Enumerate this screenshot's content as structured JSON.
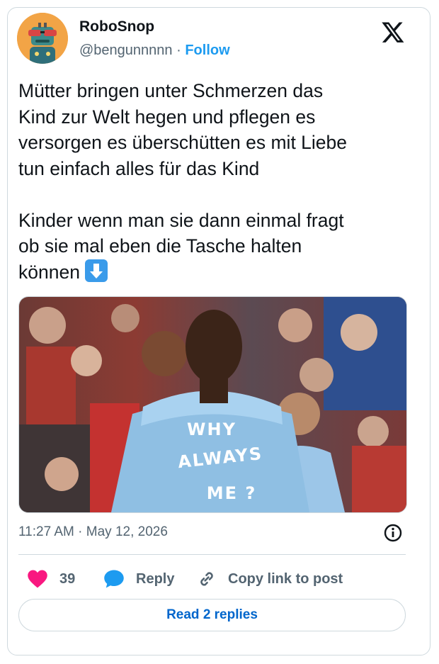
{
  "author": {
    "name": "RoboSnop",
    "handle": "@bengunnnnn",
    "separator": "·",
    "follow_label": "Follow"
  },
  "tweet": {
    "text_lines": [
      "Mütter bringen unter Schmerzen das",
      "Kind zur Welt hegen und pflegen es",
      "versorgen es überschütten es mit Liebe",
      "tun einfach alles für das Kind",
      "",
      "Kinder wenn man sie dann einmal fragt",
      "ob sie mal eben die Tasche halten",
      "können"
    ],
    "emoji": "down-arrow-emoji"
  },
  "media": {
    "shirt_text_line1": "WHY",
    "shirt_text_line2": "ALWAYS",
    "shirt_text_line3": "ME ?"
  },
  "meta": {
    "time": "11:27 AM",
    "separator": "·",
    "date": "May 12, 2026"
  },
  "actions": {
    "like_count": "39",
    "reply_label": "Reply",
    "copy_label": "Copy link to post"
  },
  "read_replies_label": "Read 2 replies",
  "colors": {
    "accent": "#1d9bf0",
    "like": "#f91880",
    "read_link": "#0066cc"
  }
}
